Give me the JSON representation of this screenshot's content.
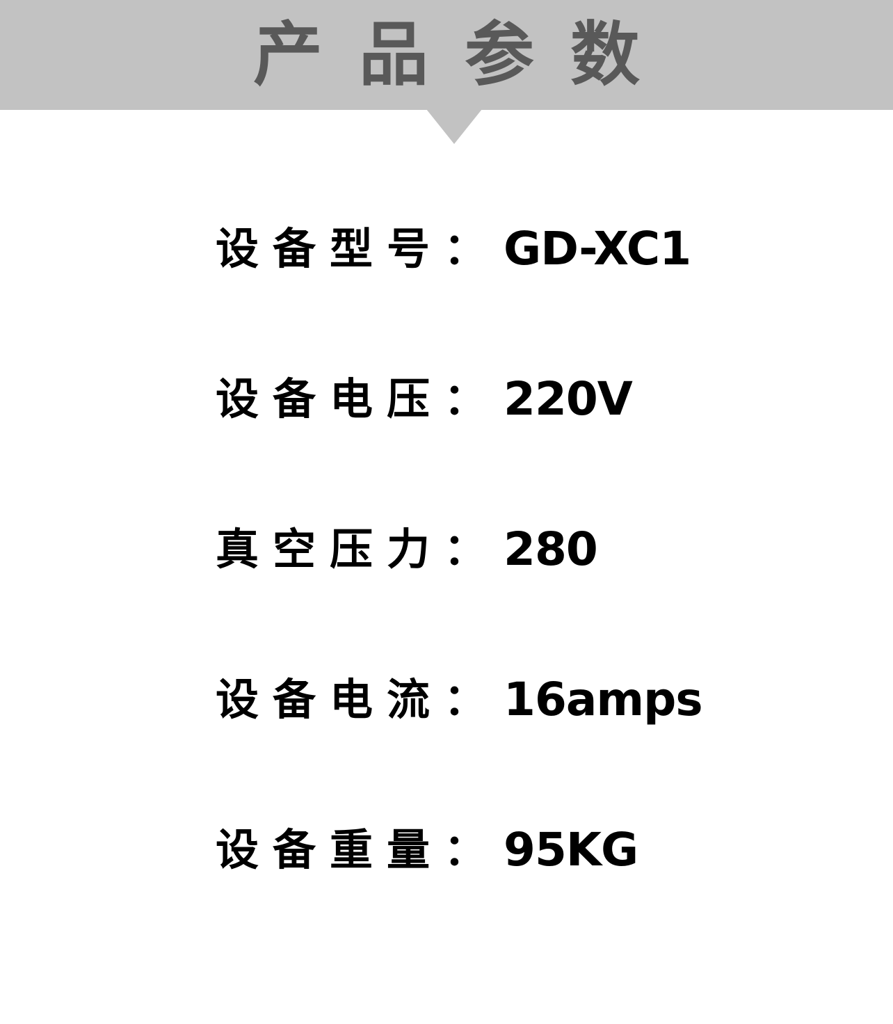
{
  "header": {
    "title": "产品参数"
  },
  "specs": [
    {
      "label": "设备型号",
      "colon": "：",
      "value": "GD-XC1"
    },
    {
      "label": "设备电压",
      "colon": "：",
      "value": "220V"
    },
    {
      "label": "真空压力",
      "colon": "：",
      "value": "280"
    },
    {
      "label": "设备电流",
      "colon": "：",
      "value": "16amps"
    },
    {
      "label": "设备重量",
      "colon": "：",
      "value": "95KG"
    }
  ],
  "colors": {
    "header_background": "#c2c2c2",
    "header_text": "#595959",
    "body_text": "#000000",
    "page_background": "#ffffff"
  }
}
